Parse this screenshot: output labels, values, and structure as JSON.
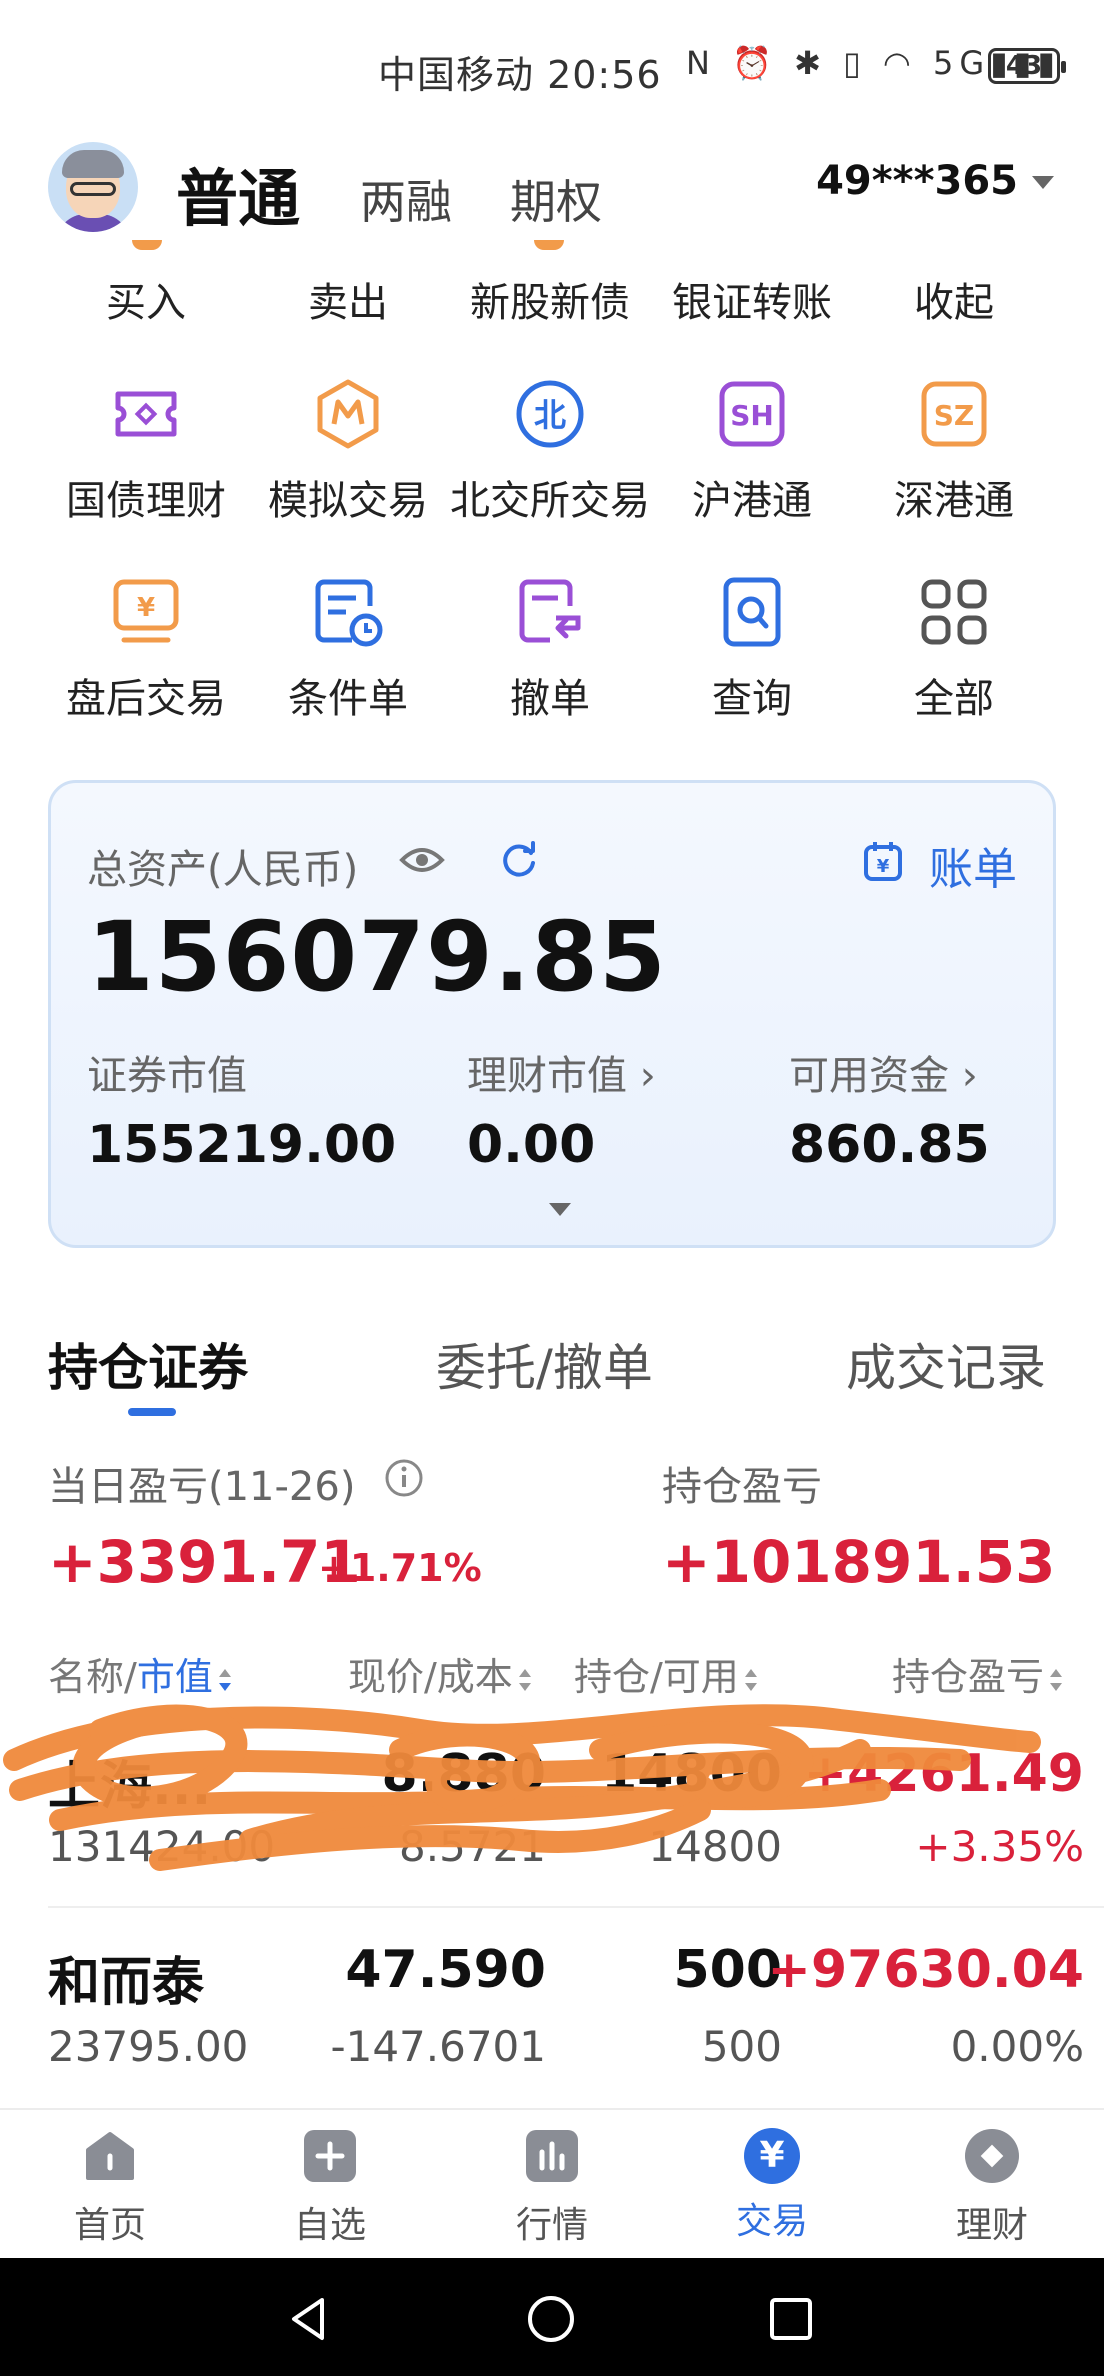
{
  "status_bar": {
    "carrier_time": "中国移动 20:56",
    "icons": "N ⏰ ✱ ▯ ◠ 5G▮▮▮",
    "battery": "43"
  },
  "header": {
    "tab_main": "普通",
    "tab_margin": "两融",
    "tab_options": "期权",
    "account": "49***365"
  },
  "quick_row": [
    "买入",
    "卖出",
    "新股新债",
    "银证转账",
    "收起"
  ],
  "function_grid": {
    "row1": [
      "国债理财",
      "模拟交易",
      "北交所交易",
      "沪港通",
      "深港通"
    ],
    "row2": [
      "盘后交易",
      "条件单",
      "撤单",
      "查询",
      "全部"
    ]
  },
  "icon_glyphs": {
    "bj": "北",
    "sh": "SH",
    "sz": "SZ",
    "yen": "¥"
  },
  "asset": {
    "title": "总资产(人民币)",
    "bill": "账单",
    "total": "156079.85",
    "securities_label": "证券市值",
    "securities_value": "155219.00",
    "wealth_label": "理财市值 ›",
    "wealth_value": "0.00",
    "cash_label": "可用资金 ›",
    "cash_value": "860.85"
  },
  "position_tabs": [
    "持仓证券",
    "委托/撤单",
    "成交记录"
  ],
  "pnl": {
    "daily_label": "当日盈亏(11-26)",
    "daily_value": "+3391.71",
    "daily_pct": "+1.71%",
    "holding_label": "持仓盈亏",
    "holding_value": "+101891.53"
  },
  "table": {
    "col1_a": "名称/",
    "col1_b": "市值",
    "col2": "现价/成本",
    "col3": "持仓/可用",
    "col4": "持仓盈亏",
    "rows": [
      {
        "name": "上海...",
        "market_value": "131424.00",
        "price": "8.880",
        "cost": "8.5721",
        "qty": "14800",
        "avail": "14800",
        "pnl": "+4261.49",
        "pnl_pct": "+3.35%"
      },
      {
        "name": "和而泰",
        "market_value": "23795.00",
        "price": "47.590",
        "cost": "-147.6701",
        "qty": "500",
        "avail": "500",
        "pnl": "+97630.04",
        "pnl_pct": "0.00%"
      }
    ]
  },
  "bottom_nav": [
    "首页",
    "自选",
    "行情",
    "交易",
    "理财"
  ],
  "colors": {
    "accent": "#2f6fe0",
    "profit": "#d9213b",
    "orange": "#f29b4a",
    "purple": "#9a4fd6",
    "scribble": "#f08a3c"
  }
}
